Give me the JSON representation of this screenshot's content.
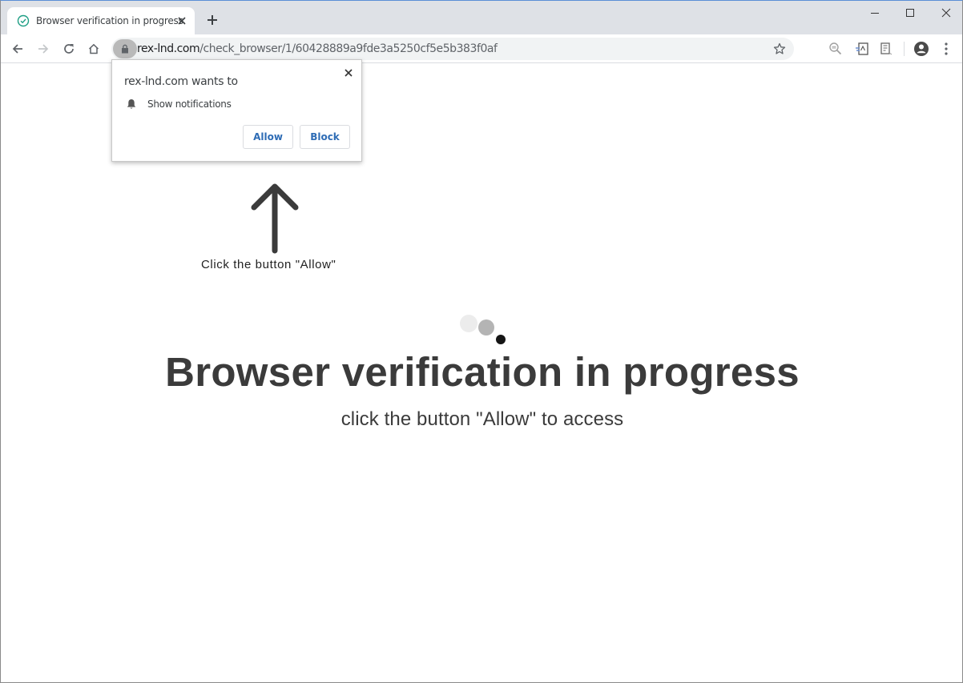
{
  "browser": {
    "tab": {
      "title": "Browser verification in progress",
      "favicon": "check-circle-icon",
      "favicon_color": "#1e9e84"
    },
    "new_tab_icon": "plus-icon",
    "window_controls": [
      "minimize-icon",
      "maximize-icon",
      "close-icon"
    ],
    "toolbar": {
      "back_icon": "arrow-left-icon",
      "forward_icon": "arrow-right-icon",
      "reload_icon": "reload-icon",
      "home_icon": "home-icon",
      "security_icon": "lock-icon",
      "url_host": "rex-lnd.com",
      "url_path": "/check_browser/1/60428889a9fde3a5250cf5e5b383f0af",
      "bookmark_icon": "star-icon",
      "extensions": [
        "zoom-icon",
        "translate-extension-icon",
        "reader-extension-icon"
      ],
      "profile_icon": "account-circle-icon",
      "menu_icon": "more-vert-icon"
    }
  },
  "permission_popup": {
    "title": "rex-lnd.com wants to",
    "permission_icon": "bell-icon",
    "permission_text": "Show notifications",
    "allow_label": "Allow",
    "block_label": "Block",
    "close_icon": "close-icon",
    "button_text_color": "#2e6cb5"
  },
  "page": {
    "arrow_icon": "arrow-up-icon",
    "hint": "Click the button \"Allow\"",
    "spinner": "loading-dots",
    "headline": "Browser verification in progress",
    "subline": "click the button \"Allow\" to access",
    "text_color": "#3b3b3b"
  }
}
